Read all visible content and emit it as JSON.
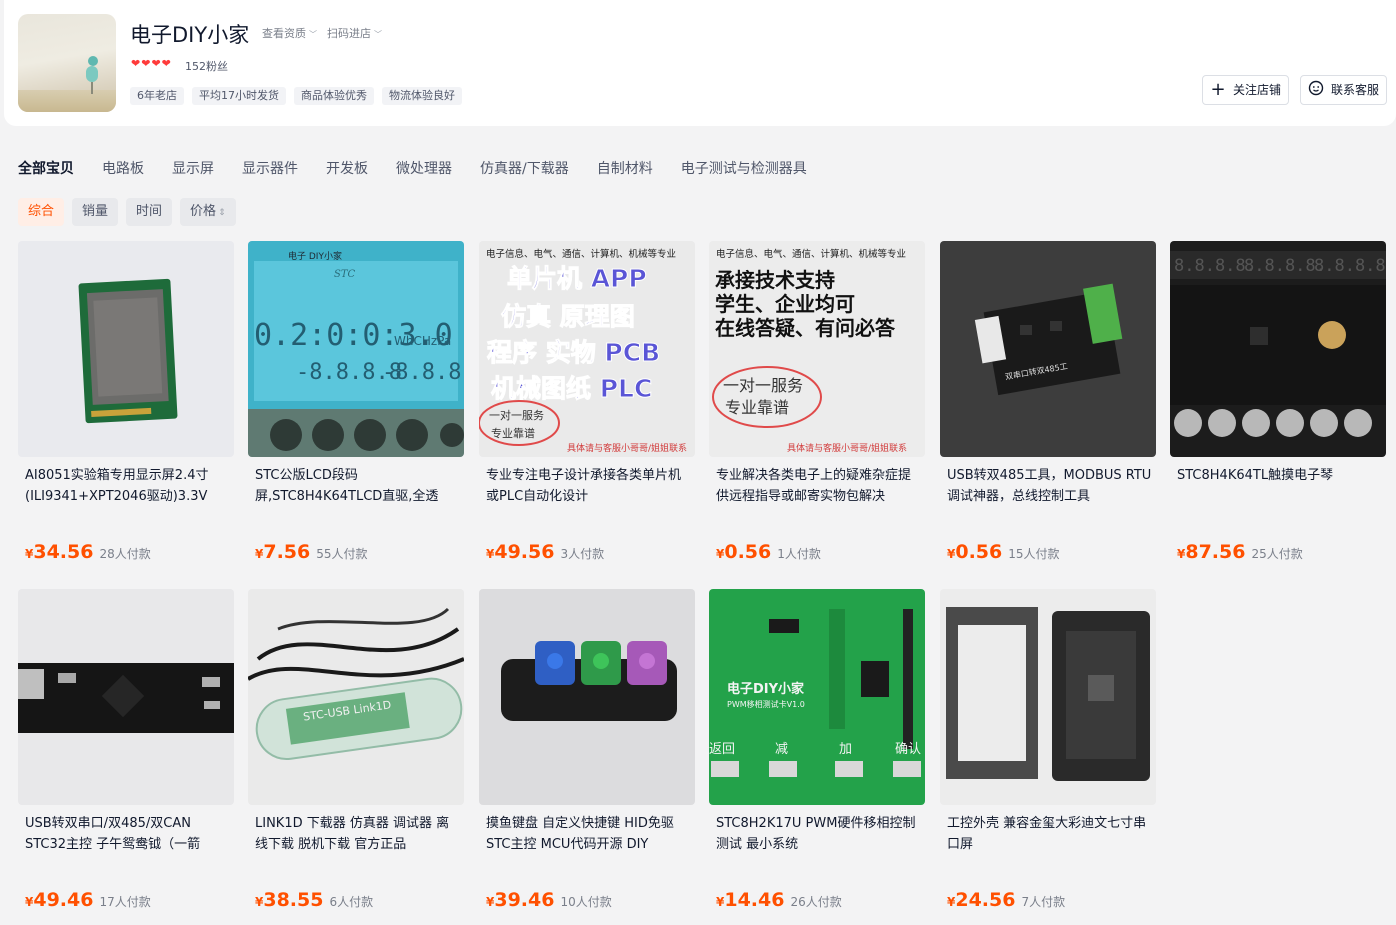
{
  "shop": {
    "name": "电子DIY小家",
    "link_resources": "查看资质",
    "link_scan": "扫码进店",
    "fans": "152粉丝",
    "tags": [
      "6年老店",
      "平均17小时发货",
      "商品体验优秀",
      "物流体验良好"
    ],
    "follow_label": "关注店铺",
    "contact_label": "联系客服",
    "rating_hearts": 4
  },
  "categories": [
    {
      "label": "全部宝贝",
      "active": true
    },
    {
      "label": "电路板"
    },
    {
      "label": "显示屏"
    },
    {
      "label": "显示器件"
    },
    {
      "label": "开发板"
    },
    {
      "label": "微处理器"
    },
    {
      "label": "仿真器/下载器"
    },
    {
      "label": "自制材料"
    },
    {
      "label": "电子测试与检测器具"
    }
  ],
  "sort": [
    {
      "label": "综合",
      "active": true
    },
    {
      "label": "销量"
    },
    {
      "label": "时间"
    },
    {
      "label": "价格"
    }
  ],
  "currency": "¥",
  "products": [
    {
      "title": "AI8051实验箱专用显示屏2.4寸(ILI9341+XPT2046驱动)3.3V",
      "price": "34.56",
      "sold": "28人付款",
      "image": "lcd-module"
    },
    {
      "title": "STC公版LCD段码屏,STC8H4K64TLCD直驱,全透",
      "price": "7.56",
      "sold": "55人付款",
      "image": "segment-lcd",
      "image_text": {
        "brand": "电子 DIY小家",
        "logo": "STC",
        "digits1": "0.2:0:0:3.0",
        "unit": "WhCHzPa",
        "digits2": "-8.8.8.8",
        "digits3": "-8.8.8.8"
      }
    },
    {
      "title": "专业专注电子设计承接各类单片机或PLC自动化设计",
      "price": "49.56",
      "sold": "3人付款",
      "image": "ad-design",
      "image_text": {
        "top": "电子信息、电气、通信、计算机、机械等专业",
        "lines": [
          "单片机 APP",
          "仿真 原理图",
          "程序 实物 PCB",
          "机械图纸 PLC"
        ],
        "circle1": "一对一服务",
        "circle2": "专业靠谱",
        "bottom": "具体请与客服小哥哥/姐姐联系"
      }
    },
    {
      "title": "专业解决各类电子上的疑难杂症提供远程指导或邮寄实物包解决",
      "price": "0.56",
      "sold": "1人付款",
      "image": "ad-support",
      "image_text": {
        "top": "电子信息、电气、通信、计算机、机械等专业",
        "lines": [
          "承接技术支持",
          "学生、企业均可",
          "在线答疑、有问必答"
        ],
        "circle1": "一对一服务",
        "circle2": "专业靠谱",
        "bottom": "具体请与客服小哥哥/姐姐联系"
      }
    },
    {
      "title": "USB转双485工具，MODBUS RTU调试神器，总线控制工具",
      "price": "0.56",
      "sold": "15人付款",
      "image": "usb-485",
      "image_text": {
        "label": "双串口转双485工"
      }
    },
    {
      "title": "STC8H4K64TL触摸电子琴",
      "price": "87.56",
      "sold": "25人付款",
      "image": "touch-piano",
      "image_text": {
        "digits": "8.8.8.8."
      }
    },
    {
      "title": "USB转双串口/双485/双CAN STC32主控 子午鸳鸯钺（一箭",
      "price": "49.46",
      "sold": "17人付款",
      "image": "usb-dual-serial"
    },
    {
      "title": "LINK1D 下载器 仿真器 调试器 离线下载 脱机下载 官方正品",
      "price": "38.55",
      "sold": "6人付款",
      "image": "link1d",
      "image_text": {
        "label": "STC-USB Link1D"
      }
    },
    {
      "title": "摸鱼键盘 自定义快捷键 HID免驱 STC主控 MCU代码开源 DIY",
      "price": "39.46",
      "sold": "10人付款",
      "image": "keyboard"
    },
    {
      "title": "STC8H2K17U PWM硬件移相控制测试 最小系统",
      "price": "14.46",
      "sold": "26人付款",
      "image": "pwm-board",
      "image_text": {
        "brand": "电子DIY小家",
        "sub": "PWM移相测试卡V1.0",
        "keys": [
          "返回",
          "减",
          "加",
          "确认"
        ]
      }
    },
    {
      "title": "工控外壳 兼容金玺大彩迪文七寸串口屏",
      "price": "24.56",
      "sold": "7人付款",
      "image": "enclosure"
    }
  ],
  "colors": {
    "accent": "#ff5000",
    "text": "#11192d",
    "muted": "#7a7f8a"
  }
}
